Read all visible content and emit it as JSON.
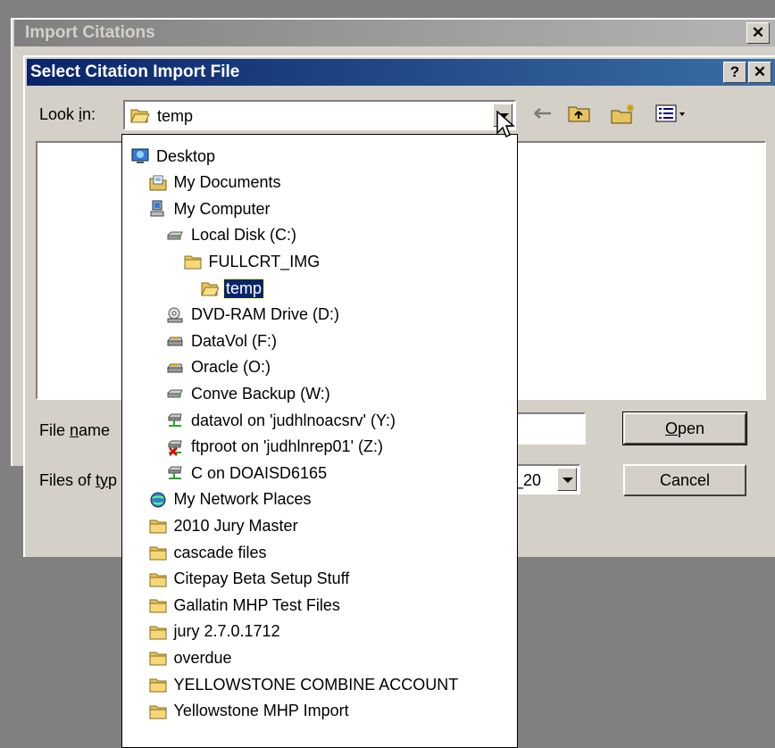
{
  "outer_dialog": {
    "title": "Import Citations",
    "close_label": "✕"
  },
  "dialog": {
    "title": "Select Citation Import File",
    "help_label": "?",
    "close_label": "✕"
  },
  "look_in": {
    "label_pre": "Look ",
    "label_key": "i",
    "label_post": "n:",
    "value": "temp"
  },
  "toolbar": {
    "back_icon": "back-arrow-icon",
    "up_icon": "up-folder-icon",
    "new_icon": "new-folder-icon",
    "view_icon": "view-menu-icon"
  },
  "file_name": {
    "label_pre": "File ",
    "label_key": "n",
    "label_post": "ame",
    "value": ""
  },
  "files_of_type": {
    "label_pre": "Files of ",
    "label_key": "ty",
    "label_post": "p",
    "value": "_20"
  },
  "buttons": {
    "open_key": "O",
    "open_rest": "pen",
    "cancel": "Cancel"
  },
  "dropdown_items": [
    {
      "label": "Desktop",
      "icon": "desktop-icon",
      "indent": 0
    },
    {
      "label": "My Documents",
      "icon": "my-documents-icon",
      "indent": 1
    },
    {
      "label": "My Computer",
      "icon": "my-computer-icon",
      "indent": 1
    },
    {
      "label": "Local Disk (C:)",
      "icon": "local-disk-icon",
      "indent": 2
    },
    {
      "label": "FULLCRT_IMG",
      "icon": "folder-icon",
      "indent": 3
    },
    {
      "label": "temp",
      "icon": "open-folder-icon",
      "indent": 4,
      "selected": true
    },
    {
      "label": "DVD-RAM Drive (D:)",
      "icon": "dvd-drive-icon",
      "indent": 2
    },
    {
      "label": "DataVol (F:)",
      "icon": "removable-drive-icon",
      "indent": 2
    },
    {
      "label": "Oracle (O:)",
      "icon": "removable-drive-icon",
      "indent": 2
    },
    {
      "label": "Conve Backup (W:)",
      "icon": "local-disk-icon",
      "indent": 2
    },
    {
      "label": "datavol on 'judhlnoacsrv' (Y:)",
      "icon": "network-drive-icon",
      "indent": 2
    },
    {
      "label": "ftproot on 'judhlnrep01' (Z:)",
      "icon": "disconnected-network-drive-icon",
      "indent": 2
    },
    {
      "label": "C on DOAISD6165",
      "icon": "network-drive-icon",
      "indent": 2
    },
    {
      "label": "My Network Places",
      "icon": "network-places-icon",
      "indent": 1
    },
    {
      "label": "2010 Jury Master",
      "icon": "folder-icon",
      "indent": 1
    },
    {
      "label": "cascade files",
      "icon": "folder-icon",
      "indent": 1
    },
    {
      "label": "Citepay Beta Setup Stuff",
      "icon": "folder-icon",
      "indent": 1
    },
    {
      "label": "Gallatin MHP Test Files",
      "icon": "folder-icon",
      "indent": 1
    },
    {
      "label": "jury 2.7.0.1712",
      "icon": "folder-icon",
      "indent": 1
    },
    {
      "label": "overdue",
      "icon": "folder-icon",
      "indent": 1
    },
    {
      "label": "YELLOWSTONE COMBINE ACCOUNT",
      "icon": "folder-icon",
      "indent": 1
    },
    {
      "label": "Yellowstone MHP Import",
      "icon": "folder-icon",
      "indent": 1
    }
  ]
}
